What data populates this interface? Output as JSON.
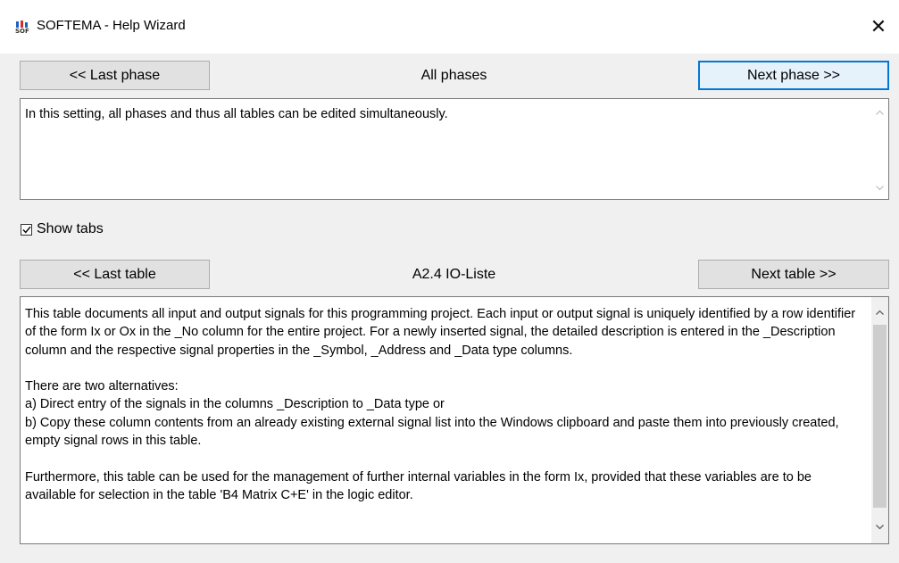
{
  "window": {
    "title": "SOFTEMA - Help Wizard",
    "close_glyph": "✕"
  },
  "phase_nav": {
    "prev_label": "<< Last phase",
    "current": "All phases",
    "next_label": "Next phase >>"
  },
  "phase_description": "In this setting, all phases and thus all tables can be edited simultaneously.",
  "show_tabs": {
    "label": "Show tabs",
    "checked": true
  },
  "table_nav": {
    "prev_label": "<< Last table",
    "current": "A2.4 IO-Liste",
    "next_label": "Next table >>"
  },
  "table_description": "This table documents all input and output signals for this programming project. Each input or output signal is uniquely identified by a row identifier of the form Ix or Ox in the _No column for the entire project. For a newly inserted signal, the detailed description is entered in the _Description column and the respective signal properties in the _Symbol, _Address and _Data type columns.\n\nThere are two alternatives:\na) Direct entry of the signals in the columns _Description to _Data type or\nb) Copy these column contents from an already existing external signal list into the Windows clipboard and paste them into previously created, empty signal rows in this table.\n\nFurthermore, this table can be used for the management of further internal variables in the form Ix, provided that these variables are to be available for selection in the table 'B4 Matrix C+E' in the logic editor.",
  "colors": {
    "focus_border": "#0078d7",
    "button_bg": "#e1e1e1",
    "dialog_bg": "#f0f0f0"
  },
  "icons": {
    "app": "softema-app-icon",
    "close": "close-icon",
    "checkmark": "checkmark-icon",
    "scroll_up": "chevron-up-icon",
    "scroll_down": "chevron-down-icon"
  }
}
